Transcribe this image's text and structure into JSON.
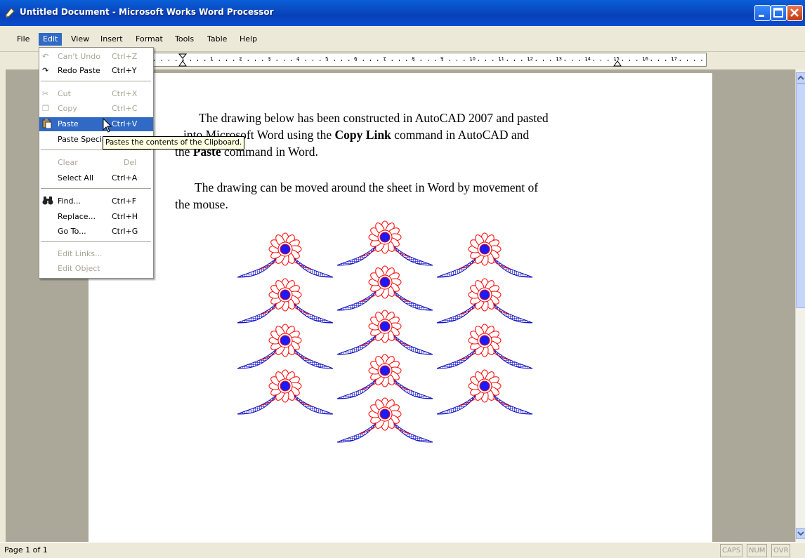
{
  "window": {
    "title": "Untitled Document - Microsoft Works Word Processor",
    "minimize_icon": "minimize-icon",
    "maximize_icon": "maximize-icon",
    "close_icon": "close-icon"
  },
  "menubar": {
    "items": [
      {
        "label": "File"
      },
      {
        "label": "Edit"
      },
      {
        "label": "View"
      },
      {
        "label": "Insert"
      },
      {
        "label": "Format"
      },
      {
        "label": "Tools"
      },
      {
        "label": "Table"
      },
      {
        "label": "Help"
      }
    ],
    "active_index": 1
  },
  "ruler": {
    "labels": [
      "1",
      "1",
      "2",
      "3",
      "4",
      "5",
      "6",
      "7",
      "8",
      "9",
      "10",
      "11",
      "12",
      "13",
      "14",
      "15",
      "16",
      "17"
    ]
  },
  "edit_menu": {
    "items": [
      {
        "label": "Can't Undo",
        "shortcut": "Ctrl+Z",
        "icon": "undo-icon",
        "disabled": true
      },
      {
        "label": "Redo Paste",
        "shortcut": "Ctrl+Y",
        "icon": "redo-icon",
        "disabled": false
      },
      {
        "label": "Cut",
        "shortcut": "Ctrl+X",
        "icon": "scissors-icon",
        "disabled": true
      },
      {
        "label": "Copy",
        "shortcut": "Ctrl+C",
        "icon": "copy-icon",
        "disabled": true
      },
      {
        "label": "Paste",
        "shortcut": "Ctrl+V",
        "icon": "clipboard-icon",
        "disabled": false,
        "selected": true
      },
      {
        "label": "Paste Special...",
        "shortcut": "",
        "icon": "",
        "disabled": false
      },
      {
        "label": "Clear",
        "shortcut": "Del",
        "icon": "",
        "disabled": true
      },
      {
        "label": "Select All",
        "shortcut": "Ctrl+A",
        "icon": "",
        "disabled": false
      },
      {
        "label": "Find...",
        "shortcut": "Ctrl+F",
        "icon": "binoculars-icon",
        "disabled": false
      },
      {
        "label": "Replace...",
        "shortcut": "Ctrl+H",
        "icon": "",
        "disabled": false
      },
      {
        "label": "Go To...",
        "shortcut": "Ctrl+G",
        "icon": "",
        "disabled": false
      },
      {
        "label": "Edit Links...",
        "shortcut": "",
        "icon": "",
        "disabled": true
      },
      {
        "label": "Edit Object",
        "shortcut": "",
        "icon": "",
        "disabled": true
      }
    ]
  },
  "tooltip": {
    "text": "Pastes the contents of the Clipboard."
  },
  "document": {
    "para1": {
      "line1": "The drawing below has been constructed in AutoCAD 2007 and pasted",
      "line2_a": "into Microsoft Word using the ",
      "line2_b": "Copy Link",
      "line2_c": " command in AutoCAD and",
      "line3_a": "the ",
      "line3_b": "Paste",
      "line3_c": " command in Word."
    },
    "para2": {
      "line1": "The drawing can be moved around the sheet in Word by movement of",
      "line2": "the mouse."
    },
    "drawing_colors": {
      "petals": "#ff0000",
      "leaves": "#1010c0",
      "center": "#1a1aff"
    }
  },
  "statusbar": {
    "page": "Page 1 of 1",
    "caps": "CAPS",
    "num": "NUM",
    "ovr": "OVR"
  }
}
